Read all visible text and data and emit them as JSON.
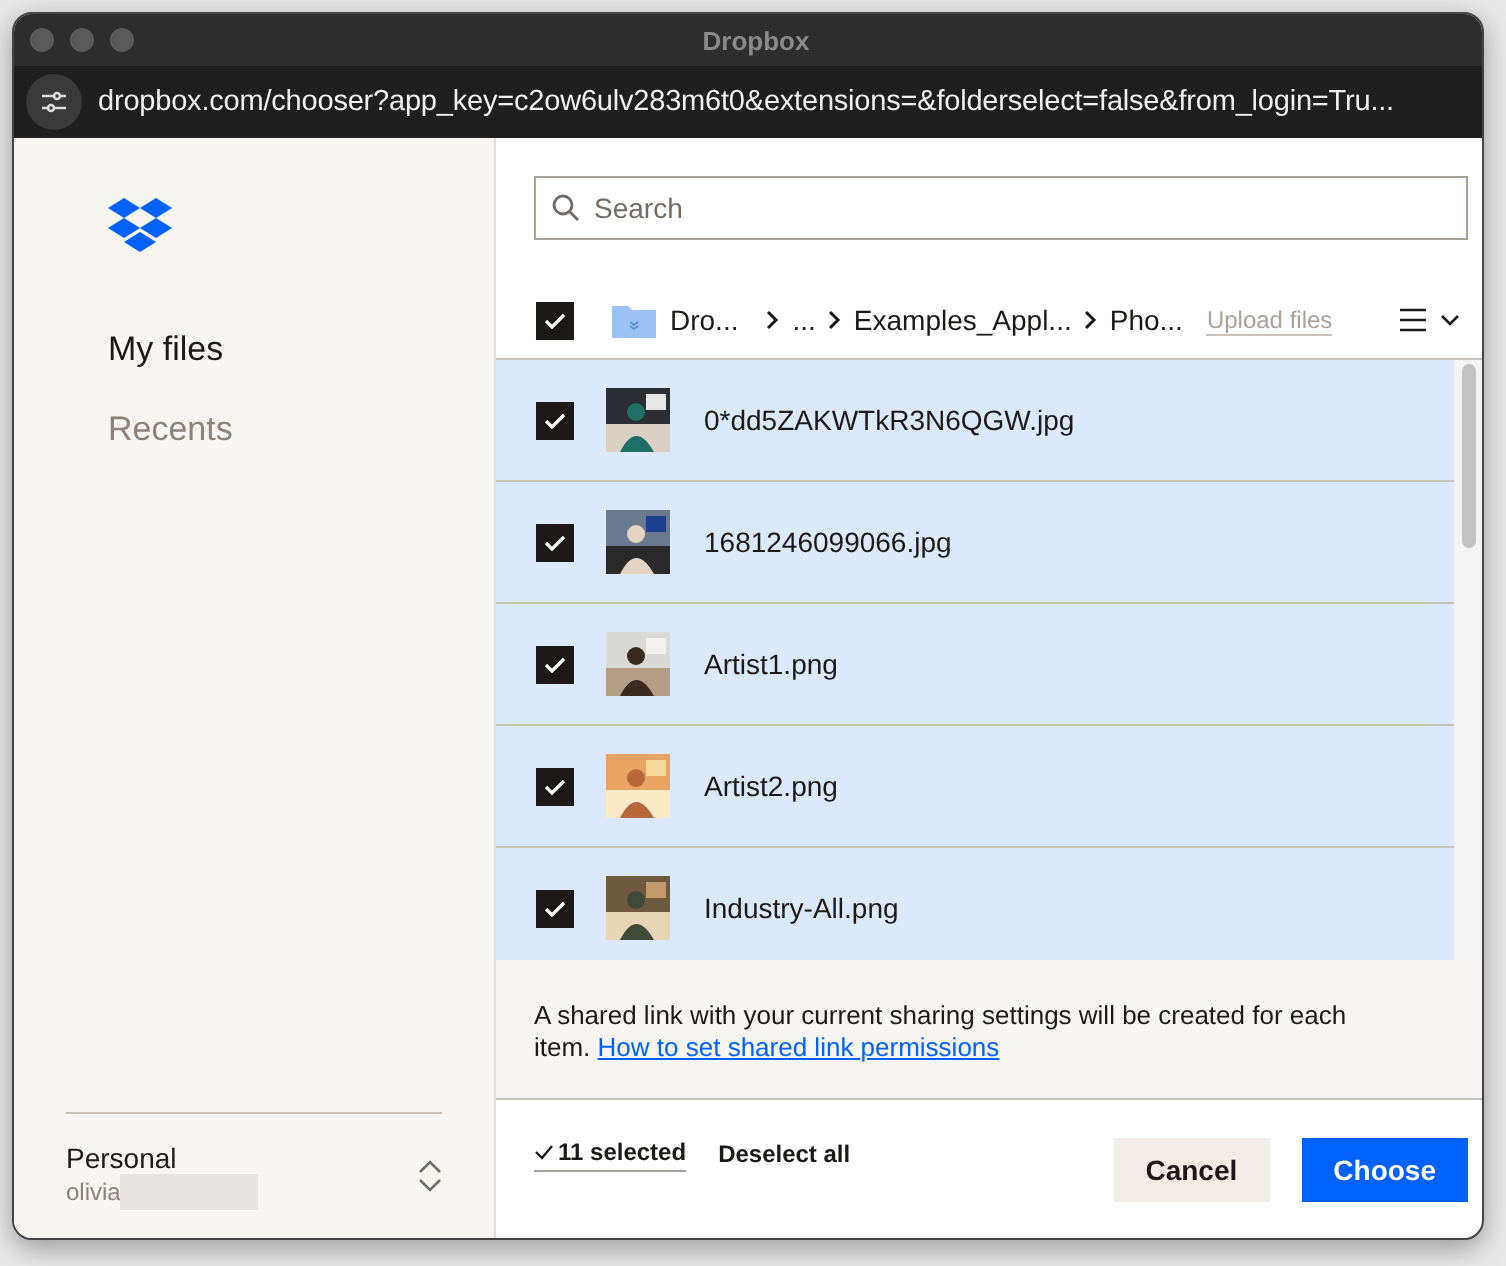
{
  "window": {
    "title": "Dropbox",
    "url": "dropbox.com/chooser?app_key=c2ow6ulv283m6t0&extensions=&folderselect=false&from_login=Tru..."
  },
  "sidebar": {
    "items": [
      {
        "label": "My files",
        "selected": true
      },
      {
        "label": "Recents",
        "selected": false
      }
    ],
    "account": {
      "type": "Personal",
      "user": "olivia"
    }
  },
  "search": {
    "placeholder": "Search"
  },
  "breadcrumb": {
    "checked": true,
    "items": [
      "Dro...",
      "...",
      "Examples_Appl...",
      "Pho..."
    ],
    "upload": "Upload files"
  },
  "files": [
    {
      "name": "0*dd5ZAKWTkR3N6QGW.jpg",
      "checked": true,
      "selected": true
    },
    {
      "name": "1681246099066.jpg",
      "checked": true,
      "selected": true
    },
    {
      "name": "Artist1.png",
      "checked": true,
      "selected": true
    },
    {
      "name": "Artist2.png",
      "checked": true,
      "selected": true
    },
    {
      "name": "Industry-All.png",
      "checked": true,
      "selected": true
    }
  ],
  "notice": {
    "text": "A shared link with your current sharing settings will be created for each item.",
    "link": "How to set shared link permissions"
  },
  "footer": {
    "selected_count": "11 selected",
    "deselect": "Deselect all",
    "cancel": "Cancel",
    "choose": "Choose"
  }
}
